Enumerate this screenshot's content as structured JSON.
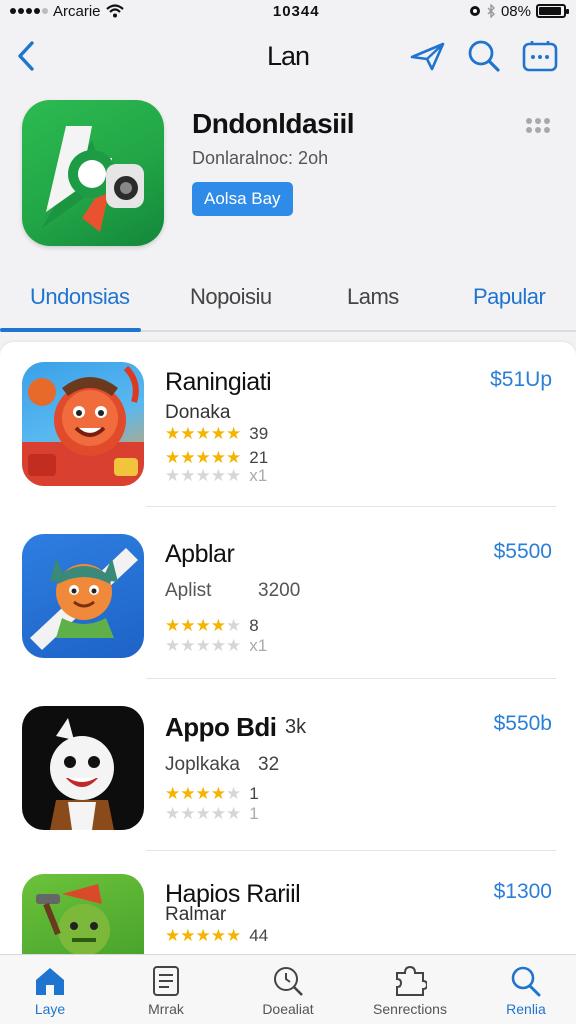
{
  "status_bar": {
    "carrier": "Arcarie",
    "time": "10344",
    "battery": "08%",
    "battery_level": 0.9
  },
  "nav": {
    "title": "Lan",
    "back_icon": "chevron-left-icon",
    "actions": [
      "send-icon",
      "search-icon",
      "more-icon"
    ]
  },
  "app": {
    "name": "Dndonldasiil",
    "subtitle": "Donlaralnoc: 2oh",
    "button_label": "Aolsa Bay",
    "colors": {
      "accent": "#2e8be8",
      "icon_green": "#22a647"
    }
  },
  "tabs": [
    {
      "label": "Undonsias",
      "active": true
    },
    {
      "label": "Nopoisiu",
      "active": false
    },
    {
      "label": "Lams",
      "active": false
    },
    {
      "label": "Papular",
      "active": false
    }
  ],
  "list": [
    {
      "name": "Raningiati",
      "subtitle": "Donaka",
      "price": "$51Up",
      "ratings": [
        {
          "stars": 5,
          "count": "39"
        },
        {
          "stars": 4.5,
          "count": "21"
        },
        {
          "stars": 0,
          "count": "x1"
        }
      ]
    },
    {
      "name": "Apblar",
      "subtitle": "Aplist",
      "subtitle_extra": "3200",
      "price": "$5500",
      "ratings": [
        {
          "stars": 4,
          "count": "8"
        },
        {
          "stars": 0,
          "count": "x1"
        }
      ]
    },
    {
      "name": "Appo Bdi",
      "name_extra": "3k",
      "subtitle": "Joplkaka",
      "subtitle_extra": "32",
      "price": "$550b",
      "ratings": [
        {
          "stars": 4,
          "count": "1"
        },
        {
          "stars": 0,
          "count": "1"
        }
      ]
    },
    {
      "name": "Hapios Rariil",
      "subtitle": "Ralmar",
      "price": "$1300",
      "ratings": [
        {
          "stars": 5,
          "count": "44"
        }
      ]
    }
  ],
  "tab_bar": [
    {
      "label": "Laye",
      "icon": "home-icon",
      "active": true
    },
    {
      "label": "Mrrak",
      "icon": "document-icon",
      "active": false
    },
    {
      "label": "Doealiat",
      "icon": "clock-search-icon",
      "active": false
    },
    {
      "label": "Senrections",
      "icon": "puzzle-icon",
      "active": false
    },
    {
      "label": "Renlia",
      "icon": "search-icon",
      "active": false
    }
  ]
}
